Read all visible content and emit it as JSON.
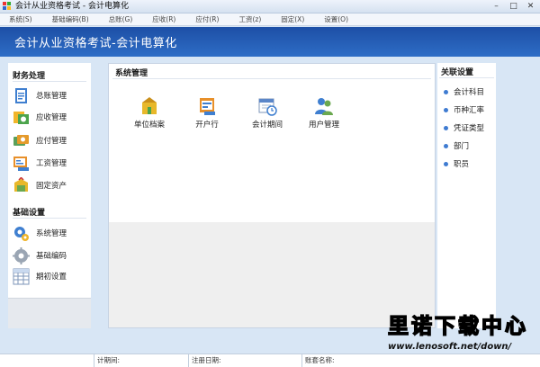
{
  "window": {
    "title": "会计从业资格考试 - 会计电算化",
    "controls": [
      "minimize-icon",
      "maximize-icon",
      "close-icon"
    ]
  },
  "menu": [
    "系统(S)",
    "基础编码(B)",
    "总账(G)",
    "应收(R)",
    "应付(R)",
    "工资(z)",
    "固定(X)",
    "设置(O)"
  ],
  "banner": {
    "title": "会计从业资格考试-会计电算化"
  },
  "sidebar": {
    "groups": [
      {
        "heading": "财务处理",
        "items": [
          {
            "label": "总账管理",
            "icon": "ledger-icon"
          },
          {
            "label": "应收管理",
            "icon": "receivable-icon"
          },
          {
            "label": "应付管理",
            "icon": "payable-icon"
          },
          {
            "label": "工资管理",
            "icon": "payroll-icon"
          },
          {
            "label": "固定资产",
            "icon": "fixed-assets-icon"
          }
        ]
      },
      {
        "heading": "基础设置",
        "items": [
          {
            "label": "系统管理",
            "icon": "system-gear-icon"
          },
          {
            "label": "基础编码",
            "icon": "encoding-gear-icon"
          },
          {
            "label": "期初设置",
            "icon": "grid-table-icon"
          }
        ]
      }
    ]
  },
  "main": {
    "title": "系统管理",
    "items": [
      {
        "label": "单位档案",
        "icon": "company-file-icon"
      },
      {
        "label": "开户行",
        "icon": "bank-card-icon"
      },
      {
        "label": "会计期间",
        "icon": "calendar-clock-icon"
      },
      {
        "label": "用户管理",
        "icon": "users-icon"
      }
    ]
  },
  "related": {
    "title": "关联设置",
    "items": [
      "会计科目",
      "币种汇率",
      "凭证类型",
      "部门",
      "职员"
    ]
  },
  "status": {
    "segments": [
      "计期间:",
      "注册日期:",
      "账套名称:"
    ]
  },
  "watermark": {
    "brand": "里诺下载中心",
    "url": "www.lenosoft.net/down/"
  },
  "colors": {
    "banner": "#2560b8",
    "bullet": "#3e7bd1",
    "watermark": "#ffe100"
  }
}
